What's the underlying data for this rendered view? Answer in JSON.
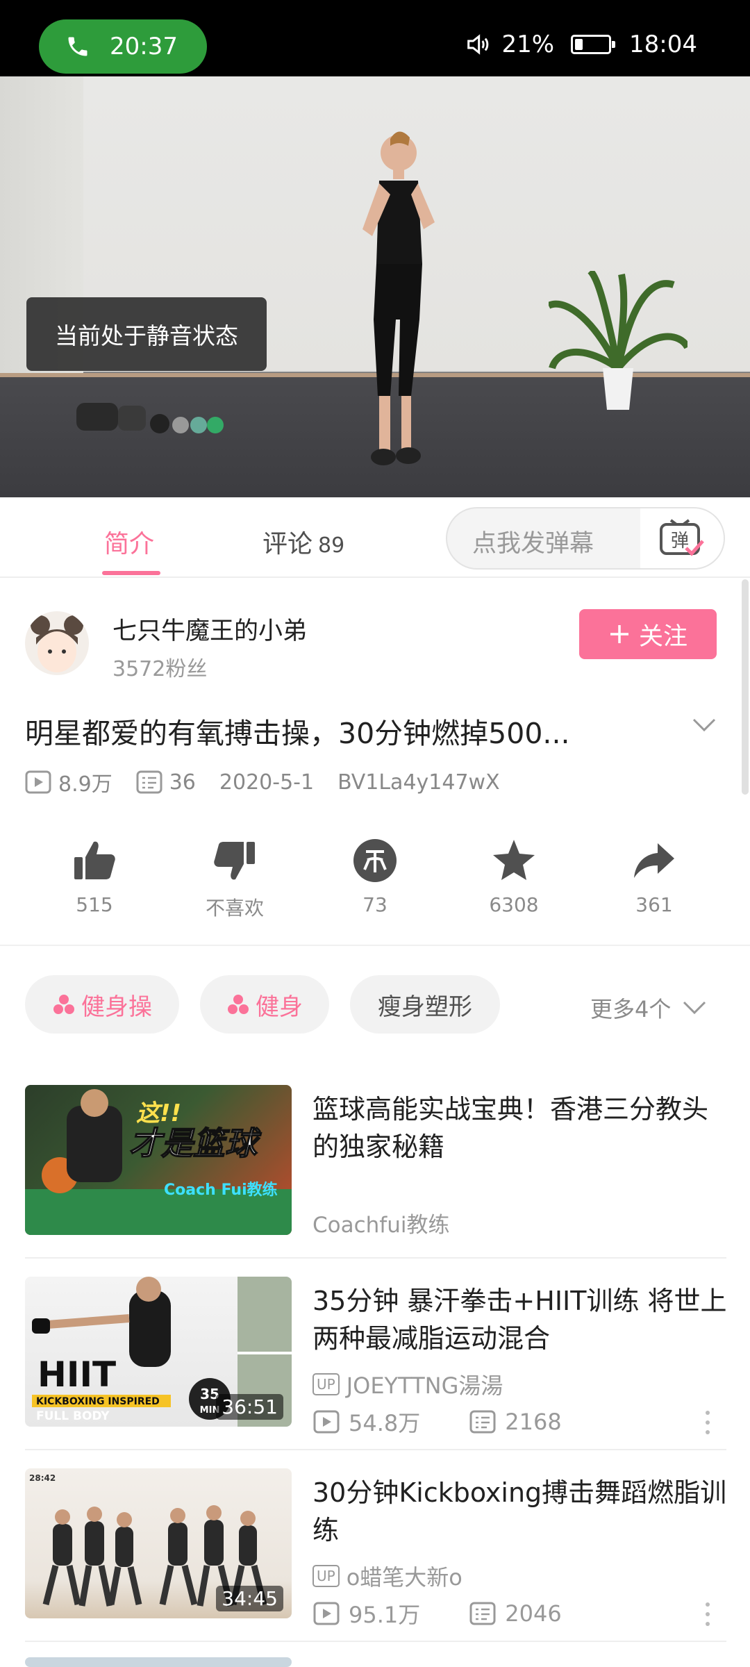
{
  "status_bar": {
    "call_timer": "20:37",
    "battery_percent": "21%",
    "battery_level": 0.21,
    "time": "18:04"
  },
  "video": {
    "mute_toast": "当前处于静音状态"
  },
  "tabs": {
    "intro": "简介",
    "comments": "评论",
    "comments_count": "89"
  },
  "danmaku": {
    "placeholder": "点我发弹幕",
    "button_glyph": "弹"
  },
  "author": {
    "name": "七只牛魔王的小弟",
    "fans": "3572粉丝",
    "follow_label": "关注"
  },
  "video_info": {
    "title": "明星都爱的有氧搏击操，30分钟燃掉500...",
    "views": "8.9万",
    "danmaku_count": "36",
    "date": "2020-5-1",
    "bvid": "BV1La4y147wX"
  },
  "actions": [
    {
      "name": "like",
      "label": "515"
    },
    {
      "name": "dislike",
      "label": "不喜欢"
    },
    {
      "name": "coin",
      "label": "73"
    },
    {
      "name": "favorite",
      "label": "6308"
    },
    {
      "name": "share",
      "label": "361"
    }
  ],
  "tags": [
    {
      "label": "健身操",
      "style": "pink"
    },
    {
      "label": "健身",
      "style": "pink"
    },
    {
      "label": "瘦身塑形",
      "style": "grey"
    }
  ],
  "more_tags": "更多4个",
  "recommendations": [
    {
      "title": "篮球高能实战宝典！香港三分教头的独家秘籍",
      "author": "Coachfui教练",
      "thumb_text_1": "这!!",
      "thumb_text_2": "才是篮球",
      "thumb_text_3": "Coach Fui教练"
    },
    {
      "title": "35分钟 暴汗拳击+HIIT训练 将世上两种最减脂运动混合",
      "up_badge": "UP",
      "author": "JOEYTTNG湯湯",
      "views": "54.8万",
      "danmaku": "2168",
      "duration": "36:51",
      "thumb_text_1": "HIIT",
      "thumb_text_2": "KICKBOXING INSPIRED",
      "thumb_text_3": "FULL BODY",
      "thumb_badge_1": "35",
      "thumb_badge_2": "MIN"
    },
    {
      "title": "30分钟Kickboxing搏击舞蹈燃脂训练",
      "up_badge": "UP",
      "author": "o蜡笔大新o",
      "views": "95.1万",
      "danmaku": "2046",
      "duration": "34:45",
      "thumb_corner": "28:42"
    }
  ],
  "colors": {
    "accent": "#fb7299",
    "call_green": "#2e9c3b",
    "action_icon": "#505050"
  }
}
